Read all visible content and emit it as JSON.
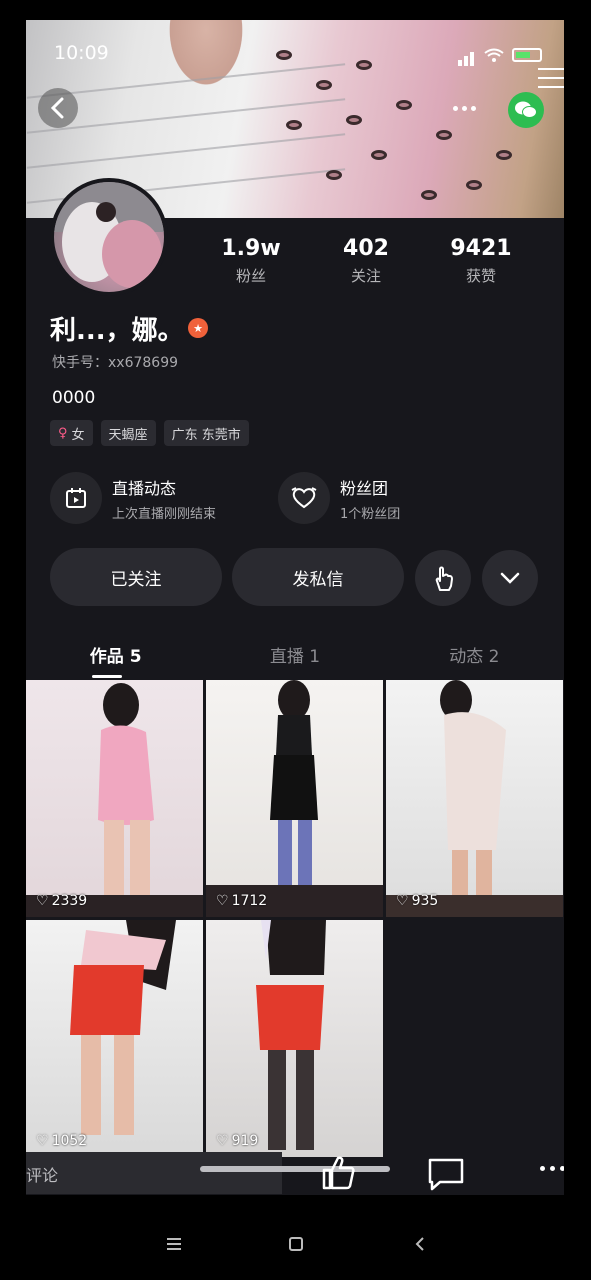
{
  "status_bar": {
    "time": "10:09"
  },
  "profile": {
    "name": "利...，娜。",
    "kuaishou_id": "快手号：xx678699",
    "bio": "0000",
    "stats": [
      {
        "value": "1.9w",
        "label": "粉丝"
      },
      {
        "value": "402",
        "label": "关注"
      },
      {
        "value": "9421",
        "label": "获赞"
      }
    ],
    "tags": [
      "女",
      "天蝎座",
      "广东 东莞市"
    ]
  },
  "info_blocks": [
    {
      "title": "直播动态",
      "subtitle": "上次直播刚刚结束",
      "icon": "calendar-live-icon"
    },
    {
      "title": "粉丝团",
      "subtitle": "1个粉丝团",
      "icon": "heart-badge-icon"
    }
  ],
  "actions": {
    "followed_label": "已关注",
    "message_label": "发私信"
  },
  "tabs": [
    {
      "label": "作品 5"
    },
    {
      "label": "直播 1"
    },
    {
      "label": "动态 2"
    }
  ],
  "grid": [
    {
      "likes": "2339"
    },
    {
      "likes": "1712"
    },
    {
      "likes": "935"
    },
    {
      "likes": "1052"
    },
    {
      "likes": "919"
    }
  ],
  "comment": {
    "placeholder": "评论"
  },
  "colors": {
    "background": "#17171c",
    "button": "#2a2a30",
    "wechat": "#2dbd51",
    "badge": "#f0613a"
  }
}
